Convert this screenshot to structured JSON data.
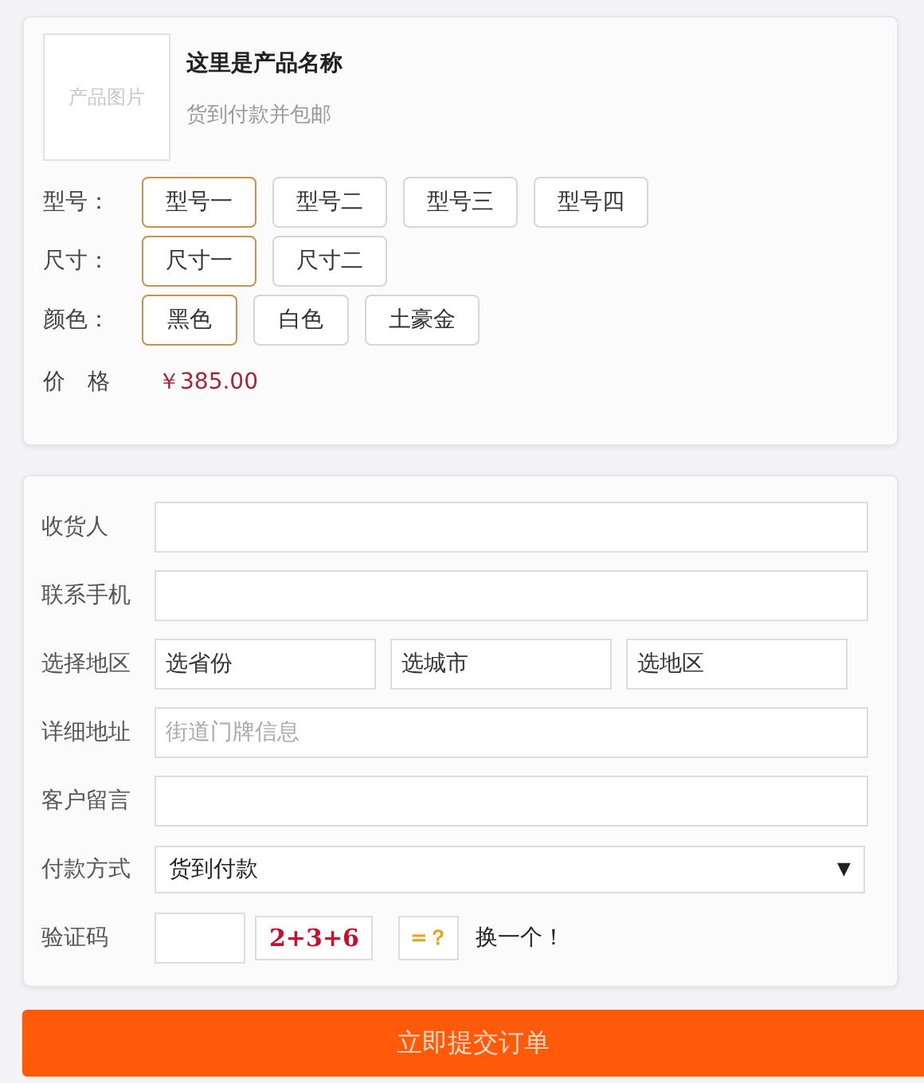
{
  "product": {
    "image_label": "产品图片",
    "name": "这里是产品名称",
    "note": "货到付款并包邮"
  },
  "option_groups": [
    {
      "label": "型号：",
      "options": [
        {
          "label": "型号一",
          "selected": true
        },
        {
          "label": "型号二",
          "selected": false
        },
        {
          "label": "型号三",
          "selected": false
        },
        {
          "label": "型号四",
          "selected": false
        }
      ]
    },
    {
      "label": "尺寸：",
      "options": [
        {
          "label": "尺寸一",
          "selected": true
        },
        {
          "label": "尺寸二",
          "selected": false
        }
      ]
    },
    {
      "label": "颜色：",
      "options": [
        {
          "label": "黑色",
          "selected": true
        },
        {
          "label": "白色",
          "selected": false
        },
        {
          "label": "土豪金",
          "selected": false
        }
      ]
    }
  ],
  "price": {
    "label": "价　格",
    "value": "￥385.00"
  },
  "form_rows": [
    {
      "kind": "text",
      "label": "收货人"
    },
    {
      "kind": "text",
      "label": "联系手机"
    },
    {
      "kind": "region",
      "label": "选择地区",
      "values": [
        "选省份",
        "选城市",
        "选地区"
      ]
    },
    {
      "kind": "text",
      "label": "详细地址",
      "placeholder": "街道门牌信息"
    },
    {
      "kind": "text",
      "label": "客户留言"
    },
    {
      "kind": "select",
      "label": "付款方式",
      "value": "货到付款",
      "arrow": "▼"
    },
    {
      "kind": "captcha",
      "label": "验证码",
      "question": "2+3+6",
      "equals": "=？",
      "refresh": "换一个！"
    }
  ],
  "submit": "立即提交订单"
}
